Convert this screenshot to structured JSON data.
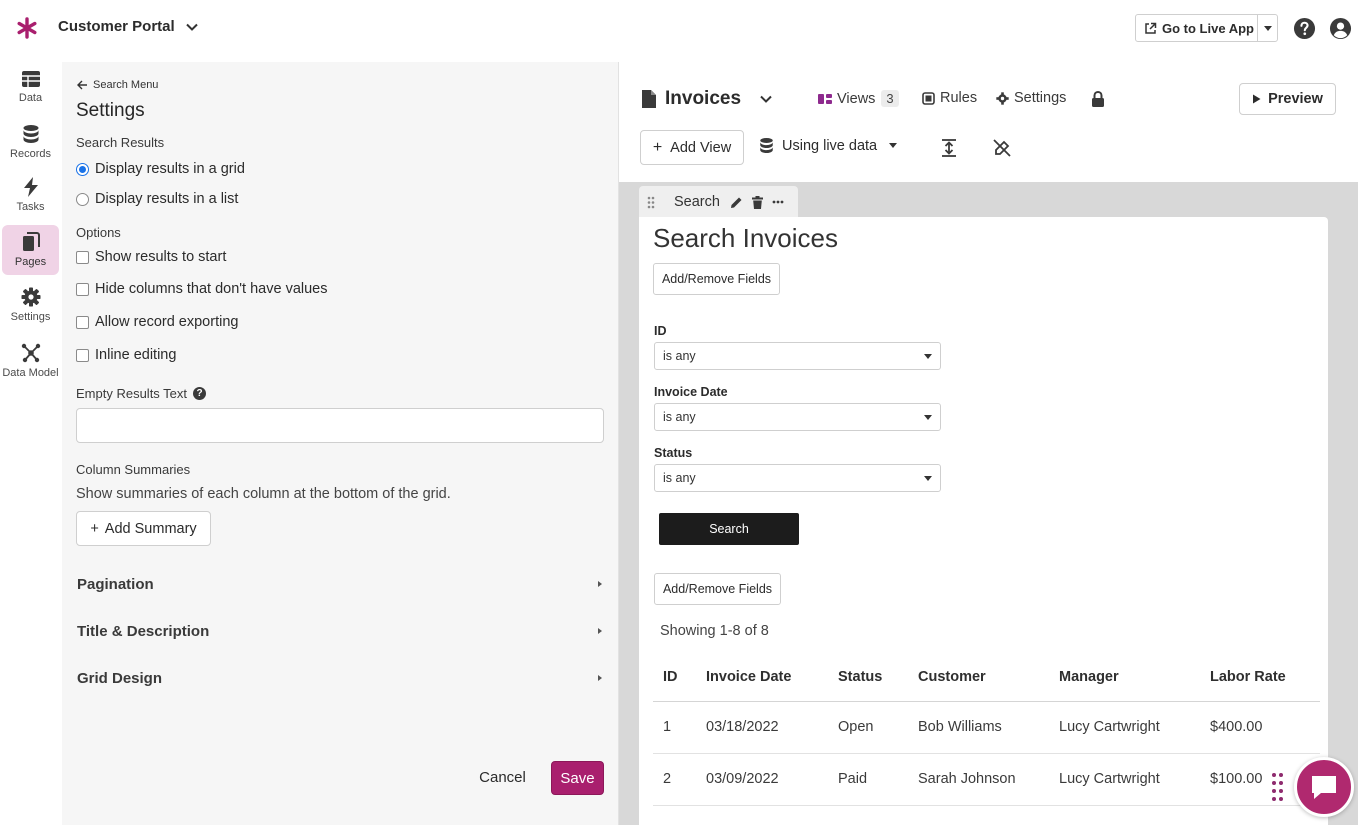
{
  "app": {
    "title": "Customer Portal",
    "live_app_label": "Go to Live App",
    "accent": "#a91f6e"
  },
  "rail": {
    "items": [
      {
        "label": "Data",
        "icon": "table-icon"
      },
      {
        "label": "Records",
        "icon": "database-icon"
      },
      {
        "label": "Tasks",
        "icon": "lightning-icon"
      },
      {
        "label": "Pages",
        "icon": "pages-icon",
        "active": true
      },
      {
        "label": "Settings",
        "icon": "gear-icon"
      },
      {
        "label": "Data Model",
        "icon": "network-icon"
      }
    ]
  },
  "settings": {
    "back_label": "Search Menu",
    "title": "Settings",
    "search_results_label": "Search Results",
    "display_grid": "Display results in a grid",
    "display_list": "Display results in a list",
    "options_label": "Options",
    "show_results": "Show results to start",
    "hide_columns": "Hide columns that don't have values",
    "allow_export": "Allow record exporting",
    "inline_editing": "Inline editing",
    "empty_results_label": "Empty Results Text",
    "empty_results_value": "",
    "column_summaries_label": "Column Summaries",
    "column_summaries_desc": "Show summaries of each column at the bottom of the grid.",
    "add_summary": "Add Summary",
    "pagination": "Pagination",
    "title_description": "Title & Description",
    "grid_design": "Grid Design",
    "cancel": "Cancel",
    "save": "Save"
  },
  "builder": {
    "object_title": "Invoices",
    "views_label": "Views",
    "views_count": "3",
    "rules_label": "Rules",
    "settings_label": "Settings",
    "preview_label": "Preview",
    "add_view_label": "Add View",
    "data_source_label": "Using live data",
    "view_tab_label": "Search",
    "card_title": "Search Invoices",
    "add_remove_fields": "Add/Remove Fields",
    "filters": [
      {
        "label": "ID",
        "value": "is any"
      },
      {
        "label": "Invoice Date",
        "value": "is any"
      },
      {
        "label": "Status",
        "value": "is any"
      }
    ],
    "search_button": "Search",
    "showing": "Showing 1-8 of 8",
    "table": {
      "headers": [
        "ID",
        "Invoice Date",
        "Status",
        "Customer",
        "Manager",
        "Labor Rate"
      ],
      "rows": [
        [
          "1",
          "03/18/2022",
          "Open",
          "Bob Williams",
          "Lucy Cartwright",
          "$400.00"
        ],
        [
          "2",
          "03/09/2022",
          "Paid",
          "Sarah Johnson",
          "Lucy Cartwright",
          "$100.00"
        ]
      ]
    }
  }
}
